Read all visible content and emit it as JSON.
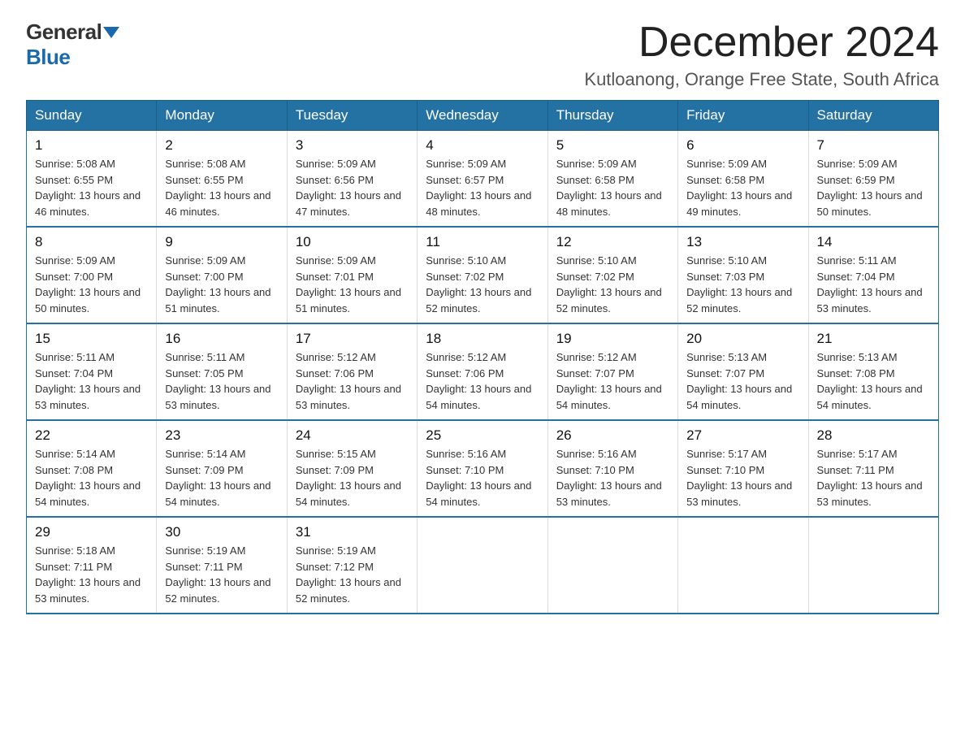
{
  "logo": {
    "general": "General",
    "blue": "Blue"
  },
  "title": "December 2024",
  "location": "Kutloanong, Orange Free State, South Africa",
  "days_of_week": [
    "Sunday",
    "Monday",
    "Tuesday",
    "Wednesday",
    "Thursday",
    "Friday",
    "Saturday"
  ],
  "weeks": [
    [
      {
        "day": "1",
        "sunrise": "5:08 AM",
        "sunset": "6:55 PM",
        "daylight": "13 hours and 46 minutes."
      },
      {
        "day": "2",
        "sunrise": "5:08 AM",
        "sunset": "6:55 PM",
        "daylight": "13 hours and 46 minutes."
      },
      {
        "day": "3",
        "sunrise": "5:09 AM",
        "sunset": "6:56 PM",
        "daylight": "13 hours and 47 minutes."
      },
      {
        "day": "4",
        "sunrise": "5:09 AM",
        "sunset": "6:57 PM",
        "daylight": "13 hours and 48 minutes."
      },
      {
        "day": "5",
        "sunrise": "5:09 AM",
        "sunset": "6:58 PM",
        "daylight": "13 hours and 48 minutes."
      },
      {
        "day": "6",
        "sunrise": "5:09 AM",
        "sunset": "6:58 PM",
        "daylight": "13 hours and 49 minutes."
      },
      {
        "day": "7",
        "sunrise": "5:09 AM",
        "sunset": "6:59 PM",
        "daylight": "13 hours and 50 minutes."
      }
    ],
    [
      {
        "day": "8",
        "sunrise": "5:09 AM",
        "sunset": "7:00 PM",
        "daylight": "13 hours and 50 minutes."
      },
      {
        "day": "9",
        "sunrise": "5:09 AM",
        "sunset": "7:00 PM",
        "daylight": "13 hours and 51 minutes."
      },
      {
        "day": "10",
        "sunrise": "5:09 AM",
        "sunset": "7:01 PM",
        "daylight": "13 hours and 51 minutes."
      },
      {
        "day": "11",
        "sunrise": "5:10 AM",
        "sunset": "7:02 PM",
        "daylight": "13 hours and 52 minutes."
      },
      {
        "day": "12",
        "sunrise": "5:10 AM",
        "sunset": "7:02 PM",
        "daylight": "13 hours and 52 minutes."
      },
      {
        "day": "13",
        "sunrise": "5:10 AM",
        "sunset": "7:03 PM",
        "daylight": "13 hours and 52 minutes."
      },
      {
        "day": "14",
        "sunrise": "5:11 AM",
        "sunset": "7:04 PM",
        "daylight": "13 hours and 53 minutes."
      }
    ],
    [
      {
        "day": "15",
        "sunrise": "5:11 AM",
        "sunset": "7:04 PM",
        "daylight": "13 hours and 53 minutes."
      },
      {
        "day": "16",
        "sunrise": "5:11 AM",
        "sunset": "7:05 PM",
        "daylight": "13 hours and 53 minutes."
      },
      {
        "day": "17",
        "sunrise": "5:12 AM",
        "sunset": "7:06 PM",
        "daylight": "13 hours and 53 minutes."
      },
      {
        "day": "18",
        "sunrise": "5:12 AM",
        "sunset": "7:06 PM",
        "daylight": "13 hours and 54 minutes."
      },
      {
        "day": "19",
        "sunrise": "5:12 AM",
        "sunset": "7:07 PM",
        "daylight": "13 hours and 54 minutes."
      },
      {
        "day": "20",
        "sunrise": "5:13 AM",
        "sunset": "7:07 PM",
        "daylight": "13 hours and 54 minutes."
      },
      {
        "day": "21",
        "sunrise": "5:13 AM",
        "sunset": "7:08 PM",
        "daylight": "13 hours and 54 minutes."
      }
    ],
    [
      {
        "day": "22",
        "sunrise": "5:14 AM",
        "sunset": "7:08 PM",
        "daylight": "13 hours and 54 minutes."
      },
      {
        "day": "23",
        "sunrise": "5:14 AM",
        "sunset": "7:09 PM",
        "daylight": "13 hours and 54 minutes."
      },
      {
        "day": "24",
        "sunrise": "5:15 AM",
        "sunset": "7:09 PM",
        "daylight": "13 hours and 54 minutes."
      },
      {
        "day": "25",
        "sunrise": "5:16 AM",
        "sunset": "7:10 PM",
        "daylight": "13 hours and 54 minutes."
      },
      {
        "day": "26",
        "sunrise": "5:16 AM",
        "sunset": "7:10 PM",
        "daylight": "13 hours and 53 minutes."
      },
      {
        "day": "27",
        "sunrise": "5:17 AM",
        "sunset": "7:10 PM",
        "daylight": "13 hours and 53 minutes."
      },
      {
        "day": "28",
        "sunrise": "5:17 AM",
        "sunset": "7:11 PM",
        "daylight": "13 hours and 53 minutes."
      }
    ],
    [
      {
        "day": "29",
        "sunrise": "5:18 AM",
        "sunset": "7:11 PM",
        "daylight": "13 hours and 53 minutes."
      },
      {
        "day": "30",
        "sunrise": "5:19 AM",
        "sunset": "7:11 PM",
        "daylight": "13 hours and 52 minutes."
      },
      {
        "day": "31",
        "sunrise": "5:19 AM",
        "sunset": "7:12 PM",
        "daylight": "13 hours and 52 minutes."
      },
      null,
      null,
      null,
      null
    ]
  ]
}
